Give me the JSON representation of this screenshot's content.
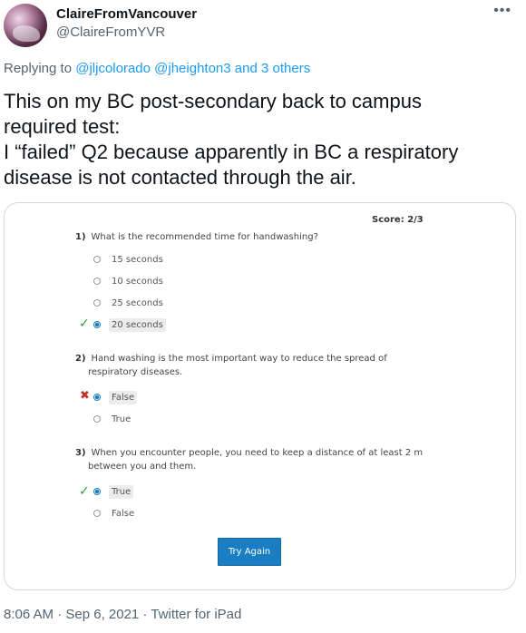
{
  "tweet": {
    "display_name": "ClaireFromVancouver",
    "handle": "@ClaireFromYVR",
    "more_icon": "more-dots-icon",
    "replying_prefix": "Replying to ",
    "replying_user1": "@jljcolorado",
    "replying_user2": "@jheighton3",
    "replying_others": "and 3 others",
    "text_lines": [
      "This on my BC post-secondary back to campus",
      "required test:",
      "I “failed” Q2 because apparently in BC a respiratory",
      "disease is not contacted through the air."
    ],
    "timestamp": "8:06 AM · Sep 6, 2021 · Twitter for iPad"
  },
  "quiz": {
    "score": "Score: 2/3",
    "questions": [
      {
        "number": "1)",
        "text": "What is the recommended time for handwashing?",
        "options": [
          "15 seconds",
          "10 seconds",
          "25 seconds",
          "20 seconds"
        ]
      },
      {
        "number": "2)",
        "text_line1": "Hand washing is the most important way to reduce the spread of",
        "text_line2": "respiratory diseases.",
        "options": [
          "False",
          "True"
        ]
      },
      {
        "number": "3)",
        "text_line1": "When you encounter people, you need to keep a distance of at least 2 m",
        "text_line2": "between you and them.",
        "options": [
          "True",
          "False"
        ]
      }
    ],
    "try_again": "Try Again",
    "colors": {
      "correct": "#2e9a3c",
      "incorrect": "#c0332c",
      "button": "#1b7ec2"
    }
  }
}
